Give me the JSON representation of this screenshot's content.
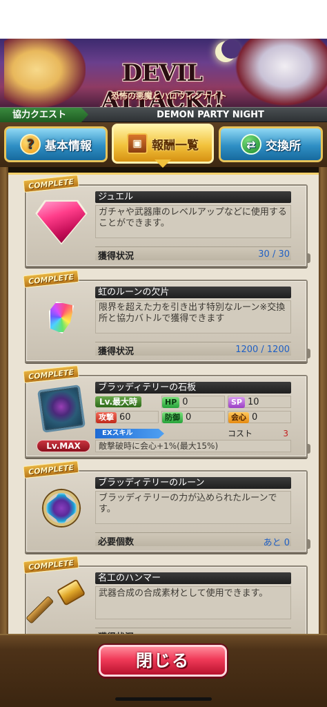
{
  "banner": {
    "logo": "DEVIL ATTACK!!",
    "subtitle": "恐怖の悪魔とハロウィンナイト"
  },
  "quest_bar": {
    "type_label": "協力クエスト",
    "event_title": "DEMON PARTY NIGHT"
  },
  "tabs": [
    {
      "label": "基本情報",
      "icon": "question-icon",
      "selected": false
    },
    {
      "label": "報酬一覧",
      "icon": "treasure-chest-icon",
      "selected": true
    },
    {
      "label": "交換所",
      "icon": "exchange-icon",
      "selected": false
    }
  ],
  "complete_label": "COMPLETE",
  "items": [
    {
      "name": "ジュエル",
      "icon": "jewel-icon",
      "description": "ガチャや武器庫のレベルアップなどに使用することができます。",
      "status_label": "獲得状況",
      "status_value": "30 / 30"
    },
    {
      "name": "虹のルーンの欠片",
      "icon": "rainbow-rune-shard-icon",
      "description": "限界を超えた力を引き出す特別なルーン※交換所と協力バトルで獲得できます",
      "status_label": "獲得状況",
      "status_value": "1200 / 1200"
    },
    {
      "name": "ブラッディテリーの石板",
      "icon": "stone-tablet-icon",
      "badge": "Lv.MAX",
      "level_label": "Lv.最大時",
      "hp_label": "HP",
      "hp_value": "0",
      "sp_label": "SP",
      "sp_value": "10",
      "atk_label": "攻撃",
      "atk_value": "60",
      "def_label": "防御",
      "def_value": "0",
      "crit_label": "会心",
      "crit_value": "0",
      "ex_skill_label": "EXスキル",
      "cost_label": "コスト",
      "cost_value": "3",
      "ex_skill_description": "敵撃破時に会心+1%(最大15%)"
    },
    {
      "name": "ブラッディテリーのルーン",
      "icon": "rune-emblem-icon",
      "description": "ブラッディテリーの力が込められたルーンです。",
      "status_label": "必要個数",
      "status_value": "あと 0"
    },
    {
      "name": "名工のハンマー",
      "icon": "hammer-icon",
      "description": "武器合成の合成素材として使用できます。",
      "status_label": "獲得状況",
      "status_value": ""
    }
  ],
  "close_button": "閉じる"
}
